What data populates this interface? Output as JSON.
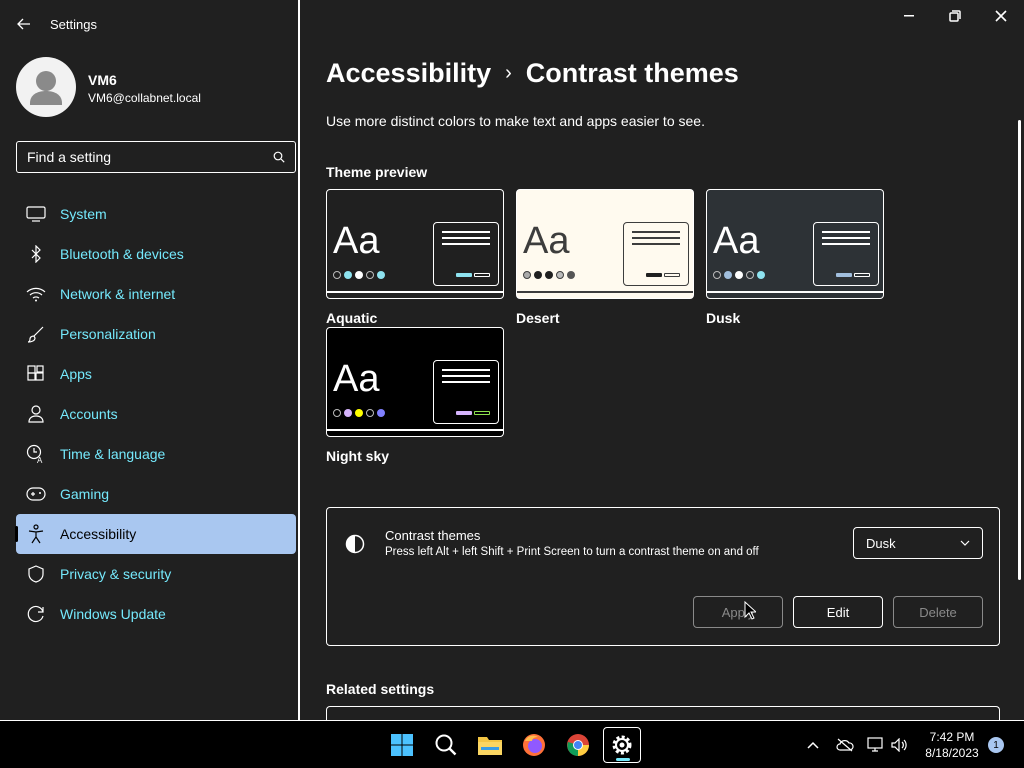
{
  "app": {
    "title": "Settings"
  },
  "user": {
    "name": "VM6",
    "email": "VM6@collabnet.local"
  },
  "search": {
    "placeholder": "Find a setting"
  },
  "nav": {
    "items": [
      {
        "label": "System",
        "icon": "monitor-icon"
      },
      {
        "label": "Bluetooth & devices",
        "icon": "bluetooth-icon"
      },
      {
        "label": "Network & internet",
        "icon": "wifi-icon"
      },
      {
        "label": "Personalization",
        "icon": "brush-icon"
      },
      {
        "label": "Apps",
        "icon": "apps-icon"
      },
      {
        "label": "Accounts",
        "icon": "person-icon"
      },
      {
        "label": "Time & language",
        "icon": "clock-globe-icon"
      },
      {
        "label": "Gaming",
        "icon": "gamepad-icon"
      },
      {
        "label": "Accessibility",
        "icon": "accessibility-icon",
        "active": true
      },
      {
        "label": "Privacy & security",
        "icon": "shield-icon"
      },
      {
        "label": "Windows Update",
        "icon": "update-icon"
      }
    ]
  },
  "page": {
    "breadcrumb_parent": "Accessibility",
    "breadcrumb_separator": "›",
    "title": "Contrast themes",
    "description": "Use more distinct colors to make text and apps easier to see.",
    "preview_heading": "Theme preview",
    "related_heading": "Related settings"
  },
  "themes": [
    {
      "name": "Aquatic",
      "sample": "Aa",
      "bg": "#202020",
      "fg": "#ffffff",
      "accent": "#8ee3f0",
      "line": "#ffffff"
    },
    {
      "name": "Desert",
      "sample": "Aa",
      "bg": "#fffaef",
      "fg": "#3d3d3d",
      "accent": "#202020",
      "line": "#3d3d3d"
    },
    {
      "name": "Dusk",
      "sample": "Aa",
      "bg": "#2d3236",
      "fg": "#ffffff",
      "accent": "#a1bfde",
      "line": "#ffffff"
    },
    {
      "name": "Night sky",
      "sample": "Aa",
      "bg": "#000000",
      "fg": "#ffffff",
      "accent": "#d6b4fd",
      "line": "#ffffff"
    }
  ],
  "contrast_setting": {
    "title": "Contrast themes",
    "subtitle": "Press left Alt + left Shift + Print Screen to turn a contrast theme on and off",
    "selected": "Dusk",
    "apply_label": "Apply",
    "edit_label": "Edit",
    "delete_label": "Delete"
  },
  "taskbar": {
    "time": "7:42 PM",
    "date": "8/18/2023",
    "notification_count": "1"
  },
  "colors": {
    "accent_link": "#75e9fc",
    "active_nav_bg": "#a9c7f0",
    "background": "#202020",
    "disabled": "#8a8a8a"
  }
}
